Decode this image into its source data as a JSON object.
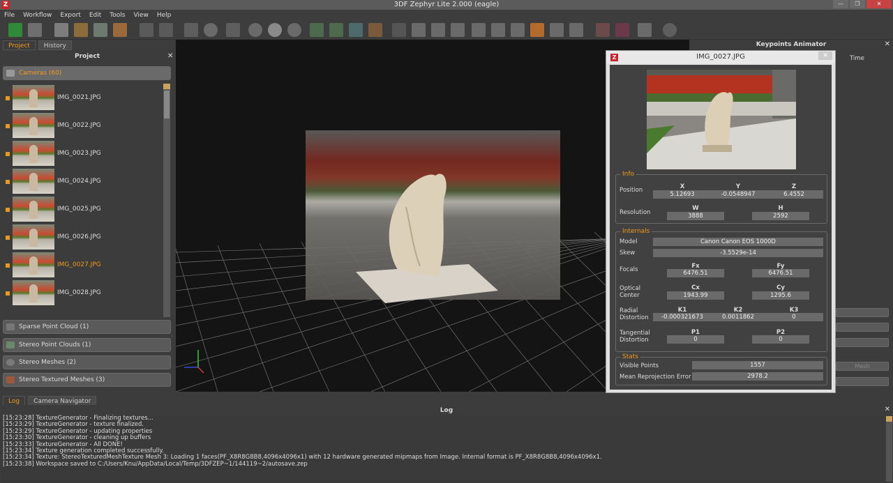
{
  "window": {
    "title": "3DF Zephyr Lite 2.000 (eagle)",
    "logo_letter": "Z"
  },
  "menu": [
    "File",
    "Workflow",
    "Export",
    "Edit",
    "Tools",
    "View",
    "Help"
  ],
  "left_panel": {
    "tabs": [
      "Project",
      "History"
    ],
    "title": "Project",
    "cameras_label": "Cameras (60)",
    "cameras": [
      "IMG_0021.JPG",
      "IMG_0022.JPG",
      "IMG_0023.JPG",
      "IMG_0024.JPG",
      "IMG_0025.JPG",
      "IMG_0026.JPG",
      "IMG_0027.JPG",
      "IMG_0028.JPG"
    ],
    "selected_camera": "IMG_0027.JPG",
    "categories": [
      "Sparse Point Cloud (1)",
      "Stereo Point Clouds (1)",
      "Stereo Meshes (2)",
      "Stereo Textured Meshes (3)"
    ]
  },
  "right_panel": {
    "title": "Keypoints Animator",
    "time_label": "Time",
    "partial_button": "Mesh"
  },
  "dialog": {
    "title": "IMG_0027.JPG",
    "info": {
      "legend": "Info",
      "position_label": "Position",
      "x_label": "X",
      "y_label": "Y",
      "z_label": "Z",
      "x": "5.12693",
      "y": "-0.0548947",
      "z": "6.4552",
      "resolution_label": "Resolution",
      "w_label": "W",
      "h_label": "H",
      "w": "3888",
      "h": "2592"
    },
    "internals": {
      "legend": "Internals",
      "model_label": "Model",
      "model": "Canon Canon EOS 1000D",
      "skew_label": "Skew",
      "skew": "-3.5529e-14",
      "focals_label": "Focals",
      "fx_label": "Fx",
      "fy_label": "Fy",
      "fx": "6476.51",
      "fy": "6476.51",
      "optical_label1": "Optical",
      "optical_label2": "Center",
      "cx_label": "Cx",
      "cy_label": "Cy",
      "cx": "1943.99",
      "cy": "1295.6",
      "radial_label1": "Radial",
      "radial_label2": "Distortion",
      "k1_label": "K1",
      "k2_label": "K2",
      "k3_label": "K3",
      "k1": "-0.000321673",
      "k2": "0.0011862",
      "k3": "0",
      "tangential_label1": "Tangential",
      "tangential_label2": "Distortion",
      "p1_label": "P1",
      "p2_label": "P2",
      "p1": "0",
      "p2": "0"
    },
    "stats": {
      "legend": "Stats",
      "visible_label": "Visible Points",
      "visible": "1557",
      "error_label": "Mean Reprojection Error",
      "error": "2978.2"
    }
  },
  "log": {
    "tabs": [
      "Log",
      "Camera Navigator"
    ],
    "title": "Log",
    "lines": [
      "[15:23:28] TextureGenerator - Finalizing textures...",
      "[15:23:29] TextureGenerator - texture finalized.",
      "[15:23:29] TextureGenerator - updating properties",
      "[15:23:30] TextureGenerator - cleaning up buffers",
      "[15:23:33] TextureGenerator - All DONE!",
      "[15:23:34] Texture generation completed successfully.",
      "[15:23:34] Texture: StereoTexturedMeshTexture Mesh 3: Loading 1 faces(PF_X8R8G8B8,4096x4096x1) with 12 hardware generated mipmaps from Image. Internal format is PF_X8R8G8B8,4096x4096x1.",
      "[15:23:38] Workspace saved to C:/Users/Knu/AppData/Local/Temp/3DFZEP~1/144119~2/autosave.zep"
    ]
  },
  "colors": {
    "accent": "#f29b1e",
    "logo_red": "#c8262b",
    "viewport_bg": "#141414",
    "panel_bg": "#3c3c3c"
  }
}
